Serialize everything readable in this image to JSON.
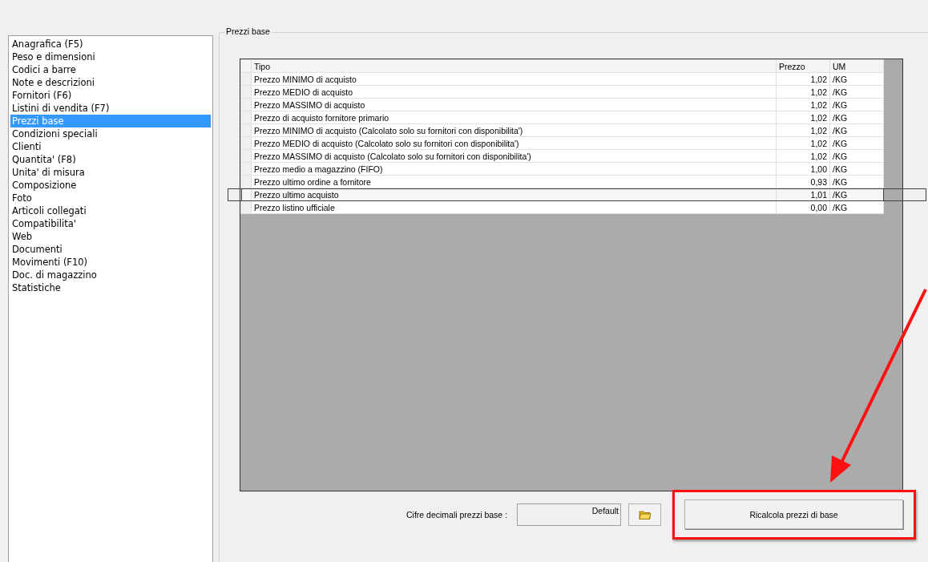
{
  "sidebar": {
    "items": [
      {
        "label": "Anagrafica (F5)",
        "selected": false
      },
      {
        "label": "Peso e dimensioni",
        "selected": false
      },
      {
        "label": "Codici a barre",
        "selected": false
      },
      {
        "label": "Note e descrizioni",
        "selected": false
      },
      {
        "label": "Fornitori (F6)",
        "selected": false
      },
      {
        "label": "Listini di vendita (F7)",
        "selected": false
      },
      {
        "label": "Prezzi base",
        "selected": true
      },
      {
        "label": "Condizioni speciali",
        "selected": false
      },
      {
        "label": "Clienti",
        "selected": false
      },
      {
        "label": "Quantita' (F8)",
        "selected": false
      },
      {
        "label": "Unita' di misura",
        "selected": false
      },
      {
        "label": "Composizione",
        "selected": false
      },
      {
        "label": "Foto",
        "selected": false
      },
      {
        "label": "Articoli collegati",
        "selected": false
      },
      {
        "label": "Compatibilita'",
        "selected": false
      },
      {
        "label": "Web",
        "selected": false
      },
      {
        "label": "Documenti",
        "selected": false
      },
      {
        "label": "Movimenti (F10)",
        "selected": false
      },
      {
        "label": "Doc. di magazzino",
        "selected": false
      },
      {
        "label": "Statistiche",
        "selected": false
      }
    ]
  },
  "panel": {
    "title": "Prezzi base",
    "table": {
      "columns": [
        "Tipo",
        "Prezzo",
        "UM"
      ],
      "rows": [
        {
          "tipo": "Prezzo MINIMO di acquisto",
          "prezzo": "1,02",
          "um": "/KG",
          "highlighted": false
        },
        {
          "tipo": "Prezzo MEDIO di acquisto",
          "prezzo": "1,02",
          "um": "/KG",
          "highlighted": false
        },
        {
          "tipo": "Prezzo MASSIMO di acquisto",
          "prezzo": "1,02",
          "um": "/KG",
          "highlighted": false
        },
        {
          "tipo": "Prezzo di acquisto fornitore primario",
          "prezzo": "1,02",
          "um": "/KG",
          "highlighted": false
        },
        {
          "tipo": "Prezzo MINIMO di acquisto (Calcolato solo su fornitori con disponibilita')",
          "prezzo": "1,02",
          "um": "/KG",
          "highlighted": false
        },
        {
          "tipo": "Prezzo MEDIO di acquisto (Calcolato solo su fornitori con disponibilita')",
          "prezzo": "1,02",
          "um": "/KG",
          "highlighted": false
        },
        {
          "tipo": "Prezzo MASSIMO di acquisto (Calcolato solo su fornitori con disponibilita')",
          "prezzo": "1,02",
          "um": "/KG",
          "highlighted": false
        },
        {
          "tipo": "Prezzo medio a magazzino (FIFO)",
          "prezzo": "1,00",
          "um": "/KG",
          "highlighted": false
        },
        {
          "tipo": "Prezzo ultimo ordine a fornitore",
          "prezzo": "0,93",
          "um": "/KG",
          "highlighted": false
        },
        {
          "tipo": "Prezzo ultimo acquisto",
          "prezzo": "1,01",
          "um": "/KG",
          "highlighted": true
        },
        {
          "tipo": "Prezzo listino ufficiale",
          "prezzo": "0,00",
          "um": "/KG",
          "highlighted": false
        }
      ]
    },
    "decimals": {
      "label": "Cifre decimali prezzi base :",
      "value": "Default"
    },
    "recalc_button": {
      "label": "Ricalcola prezzi di base",
      "highlighted": true
    }
  }
}
